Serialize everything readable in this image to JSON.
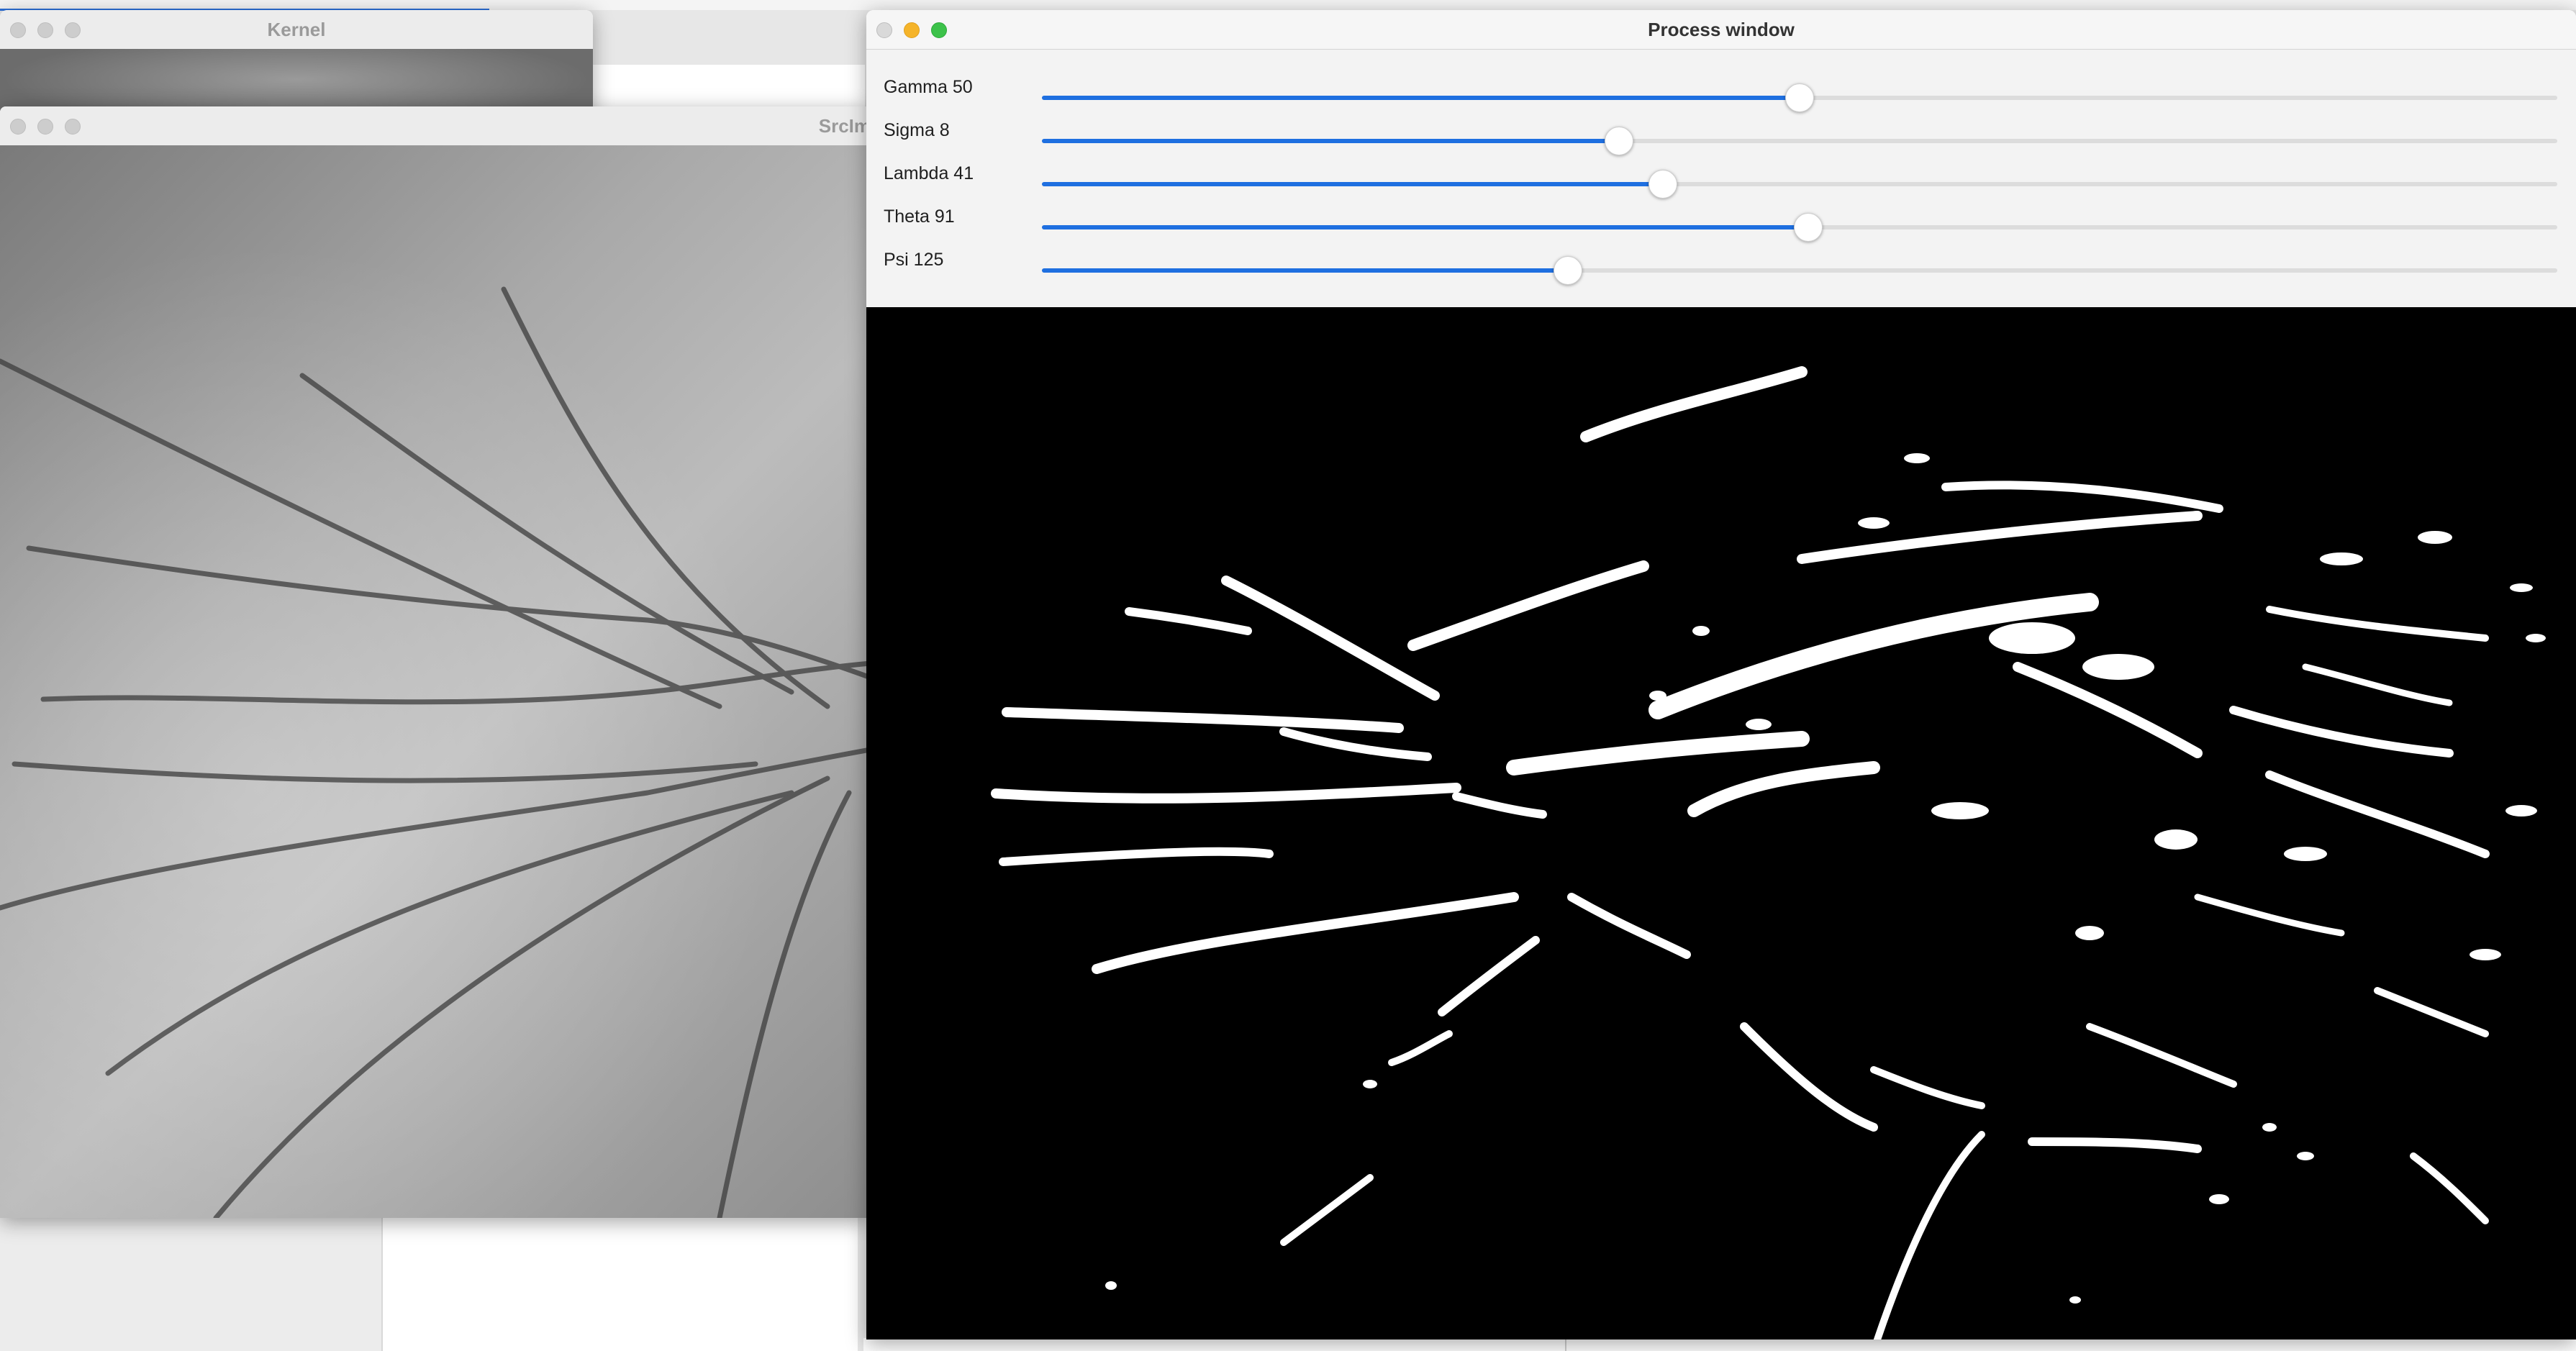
{
  "windows": {
    "kernel": {
      "title": "Kernel"
    },
    "source": {
      "title": "SrcIm"
    },
    "process": {
      "title": "Process window",
      "sliders": [
        {
          "label": "Gamma 50",
          "value": 50,
          "max": 100
        },
        {
          "label": "Sigma 8",
          "value": 8,
          "max": 21
        },
        {
          "label": "Lambda 41",
          "value": 41,
          "max": 100
        },
        {
          "label": "Theta 91",
          "value": 91,
          "max": 180
        },
        {
          "label": "Psi 125",
          "value": 125,
          "max": 360
        }
      ]
    }
  },
  "colors": {
    "accent": "#1e6fe0",
    "output_background": "#000000",
    "output_foreground": "#ffffff"
  }
}
